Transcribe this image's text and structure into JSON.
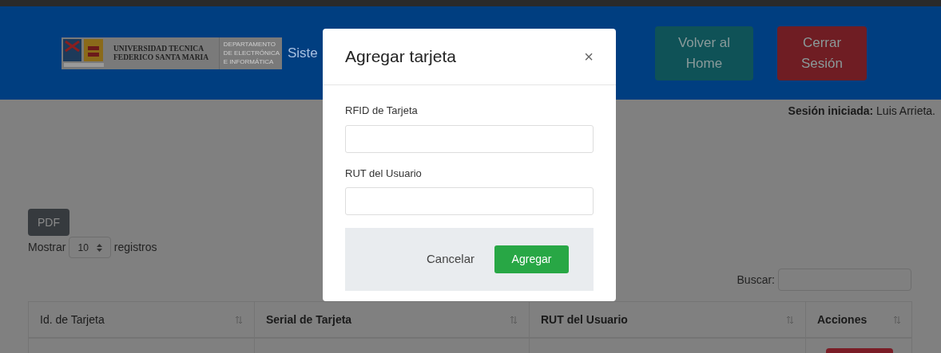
{
  "header": {
    "logo": {
      "university": [
        "UNIVERSIDAD TECNICA",
        "FEDERICO SANTA MARIA"
      ],
      "department": [
        "DEPARTAMENTO",
        "DE ELECTRÓNICA",
        "E INFORMÁTICA"
      ]
    },
    "title": "Siste",
    "buttons": [
      {
        "label": "Volver al Home",
        "kind": "home"
      },
      {
        "label": "Cerrar Sesión",
        "kind": "logout"
      }
    ]
  },
  "session": {
    "label": "Sesión iniciada:",
    "user": "Luis Arrieta."
  },
  "toolbar": {
    "pdf": "PDF",
    "show_prefix": "Mostrar",
    "page_size": "10",
    "show_suffix": "registros",
    "search_label": "Buscar:"
  },
  "table": {
    "columns": [
      {
        "label": "Id. de Tarjeta",
        "bold": false
      },
      {
        "label": "Serial de Tarjeta",
        "bold": true
      },
      {
        "label": "RUT del Usuario",
        "bold": true
      },
      {
        "label": "Acciones",
        "bold": true
      }
    ]
  },
  "modal": {
    "title": "Agregar tarjeta",
    "close": "×",
    "fields": [
      {
        "label": "RFID de Tarjeta"
      },
      {
        "label": "RUT del Usuario"
      }
    ],
    "cancel": "Cancelar",
    "submit": "Agregar"
  }
}
